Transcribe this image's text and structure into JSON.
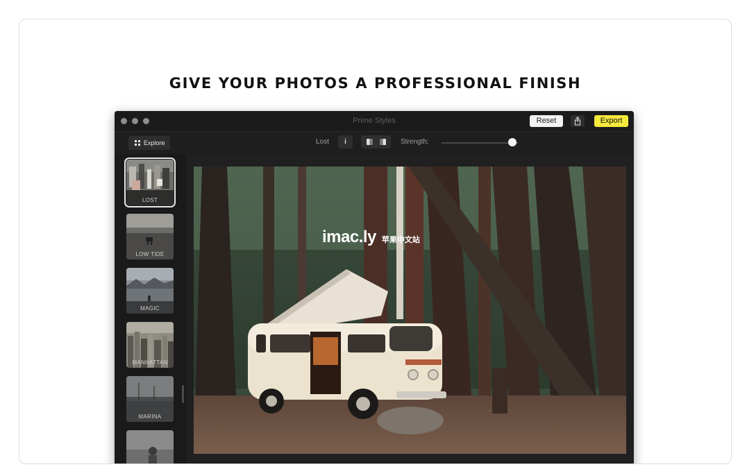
{
  "headline": "GIVE YOUR PHOTOS A PROFESSIONAL FINISH",
  "window": {
    "title": "Prime Styles",
    "reset_label": "Reset",
    "share_icon": "share-icon",
    "export_label": "Export",
    "export_color": "#f5e93b"
  },
  "toolbar": {
    "explore_label": "Explore",
    "style_name": "Lost",
    "info_label": "i",
    "strength_label": "Strength:",
    "strength_value": 0.93
  },
  "sidebar": {
    "items": [
      {
        "label": "LOST",
        "selected": true
      },
      {
        "label": "LOW TIDE"
      },
      {
        "label": "MAGIC"
      },
      {
        "label": "MANHATTAN"
      },
      {
        "label": "MARINA"
      },
      {
        "label": ""
      }
    ]
  },
  "watermark": {
    "brand": "imac.ly",
    "cn": "苹果中文站"
  }
}
